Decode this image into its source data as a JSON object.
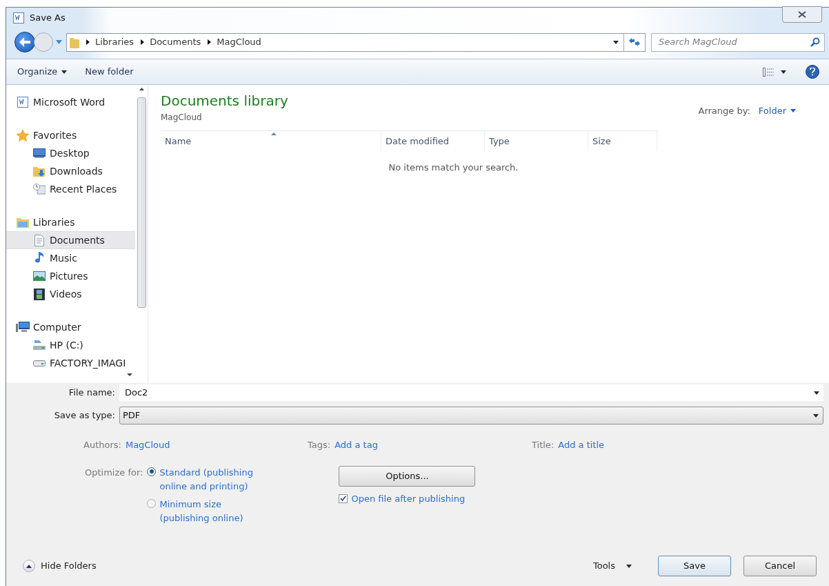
{
  "window": {
    "title": "Save As"
  },
  "address_bar": {
    "crumbs": [
      "Libraries",
      "Documents",
      "MagCloud"
    ]
  },
  "search": {
    "placeholder": "Search MagCloud"
  },
  "toolbar": {
    "organize": "Organize",
    "new_folder": "New folder"
  },
  "sidebar": {
    "sections": [
      {
        "label": "Microsoft Word",
        "selected": false
      },
      {
        "label": "Favorites",
        "selected": false,
        "children": [
          {
            "label": "Desktop",
            "selected": false
          },
          {
            "label": "Downloads",
            "selected": false
          },
          {
            "label": "Recent Places",
            "selected": false
          }
        ]
      },
      {
        "label": "Libraries",
        "selected": false,
        "children": [
          {
            "label": "Documents",
            "selected": true
          },
          {
            "label": "Music",
            "selected": false
          },
          {
            "label": "Pictures",
            "selected": false
          },
          {
            "label": "Videos",
            "selected": false
          }
        ]
      },
      {
        "label": "Computer",
        "selected": false,
        "children": [
          {
            "label": "HP (C:)",
            "selected": false
          },
          {
            "label": "FACTORY_IMAGI",
            "selected": false
          }
        ]
      }
    ]
  },
  "library": {
    "title": "Documents library",
    "subtitle": "MagCloud",
    "arrange_label": "Arrange by:",
    "arrange_value": "Folder"
  },
  "table": {
    "columns": [
      {
        "label": "Name",
        "sorted": true
      },
      {
        "label": "Date modified",
        "sorted": false
      },
      {
        "label": "Type",
        "sorted": false
      },
      {
        "label": "Size",
        "sorted": false
      }
    ],
    "empty_message": "No items match your search."
  },
  "file_name": {
    "label": "File name:",
    "value": "Doc2"
  },
  "save_as_type": {
    "label": "Save as type:",
    "value": "PDF"
  },
  "meta": [
    {
      "label": "Authors:",
      "value": "MagCloud"
    },
    {
      "label": "Tags:",
      "value": "Add a tag"
    },
    {
      "label": "Title:",
      "value": "Add a title"
    }
  ],
  "optimize": {
    "label": "Optimize for:",
    "options": [
      {
        "label": "Standard (publishing online and printing)",
        "selected": true
      },
      {
        "label": "Minimum size (publishing online)",
        "selected": false
      }
    ]
  },
  "options_button": "Options...",
  "open_after": {
    "label": "Open file after publishing",
    "checked": true
  },
  "hide_folders": "Hide Folders",
  "tools": "Tools",
  "buttons": [
    {
      "label": "Save",
      "default": true
    },
    {
      "label": "Cancel",
      "default": false
    }
  ]
}
